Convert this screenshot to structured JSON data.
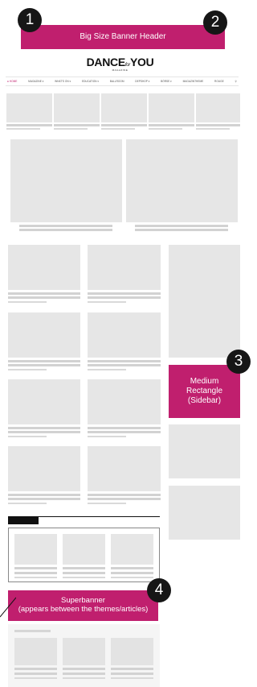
{
  "header_banner": {
    "label": "Big Size Banner Header"
  },
  "logo": {
    "main_a": "DANCE",
    "main_for": "for",
    "main_b": "YOU",
    "sub": "MAGAZINE"
  },
  "nav": {
    "items": [
      {
        "label": "● HOME",
        "active": true
      },
      {
        "label": "MAGAZINE ▾",
        "active": false
      },
      {
        "label": "WHAT'S ON ▾",
        "active": false
      },
      {
        "label": "EDUCATION ▾",
        "active": false
      },
      {
        "label": "BALLROOM",
        "active": false
      },
      {
        "label": "DEPSHOP ▾",
        "active": false
      },
      {
        "label": "BÖRSE ▾",
        "active": false
      },
      {
        "label": "MAGAZINTHEME",
        "active": false
      },
      {
        "label": "ROUGE",
        "active": false
      },
      {
        "label": "⚲",
        "active": false
      }
    ]
  },
  "medium_rectangle": {
    "line1": "Medium",
    "line2": "Rectangle",
    "line3": "(Sidebar)"
  },
  "superbanner": {
    "line1": "Superbanner",
    "line2": "(appears between the themes/articles)"
  },
  "badges": {
    "b1": "1",
    "b2": "2",
    "b3": "3",
    "b4": "4"
  },
  "colors": {
    "accent": "#c01f6e",
    "placeholder": "#e6e6e6",
    "badge": "#161616"
  }
}
